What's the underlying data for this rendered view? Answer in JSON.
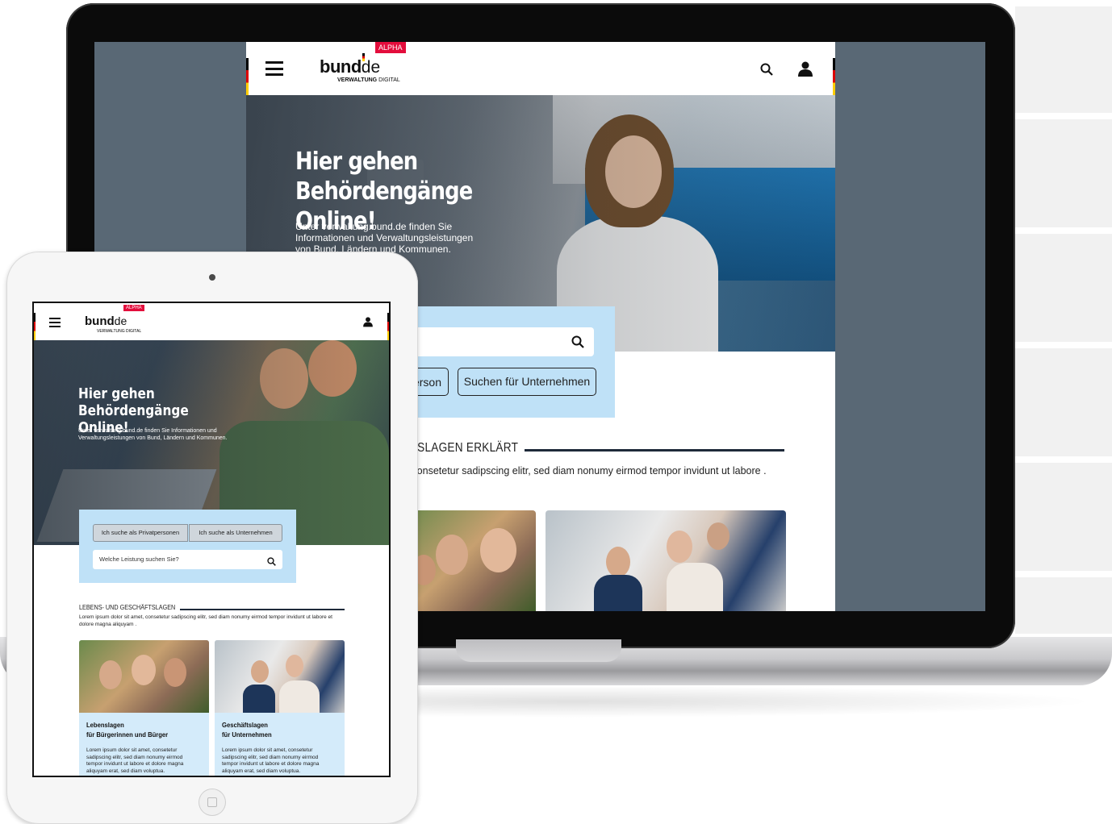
{
  "laptop_site": {
    "alpha_badge": "ALPHA",
    "logo": {
      "bund": "bund",
      "de": "de",
      "sub_bold": "VERWALTUNG",
      "sub": " DIGITAL"
    },
    "hero": {
      "title": "Hier gehen Behördengänge Online!",
      "text": "Unter verwaltung.bund.de finden Sie Informationen und Verwaltungsleistungen von Bund, Ländern und Kommunen."
    },
    "search": {
      "button_private": "erson",
      "button_business": "Suchen für Unternehmen"
    },
    "section": {
      "title": "FTSLAGEN ERKLÄRT",
      "text": "t, consetetur sadipscing elitr, sed diam nonumy eirmod tempor invidunt ut labore ."
    }
  },
  "tablet_site": {
    "alpha_badge": "ALPHA",
    "logo": {
      "bund": "bund",
      "de": "de",
      "sub": "VERWALTUNG DIGITAL"
    },
    "hero": {
      "title": "Hier gehen Behördengänge Online!",
      "text": "Unter verwaltung.bund.de finden Sie Informationen und Verwaltungsleistungen von Bund, Ländern und Kommunen."
    },
    "search": {
      "button_private": "Ich suche als Privatpersonen",
      "button_business": "Ich suche als Unternehmen",
      "placeholder": "Welche Leistung suchen Sie?"
    },
    "section": {
      "title": "LEBENS- UND GESCHÄFTSLAGEN",
      "text": "Lorem ipsum dolor sit amet, consetetur sadipscing elitr, sed diam nonumy eirmod tempor invidunt ut labore et dolore magna aliquyam ."
    },
    "cards": [
      {
        "title_line1": "Lebenslagen",
        "title_line2": "für Bürgerinnen und Bürger",
        "text": "Lorem ipsum dolor sit amet, consetetur sadipscing elitr, sed diam nonumy eirmod tempor invidunt ut labore et dolore magna aliquyam erat, sed diam voluptua."
      },
      {
        "title_line1": "Geschäftslagen",
        "title_line2": "für Unternehmen",
        "text": "Lorem ipsum dolor sit amet, consetetur sadipscing elitr, sed diam nonumy eirmod tempor invidunt ut labore et dolore magna aliquyam erat, sed diam voluptua."
      }
    ]
  },
  "colors": {
    "alpha": "#e30d3c",
    "search_panel": "#bfe1f7",
    "card_bg": "#d4ebfa",
    "laptop_bg": "#596875"
  },
  "icons": [
    "menu-icon",
    "search-icon",
    "user-icon",
    "camera-icon",
    "home-button-icon"
  ]
}
